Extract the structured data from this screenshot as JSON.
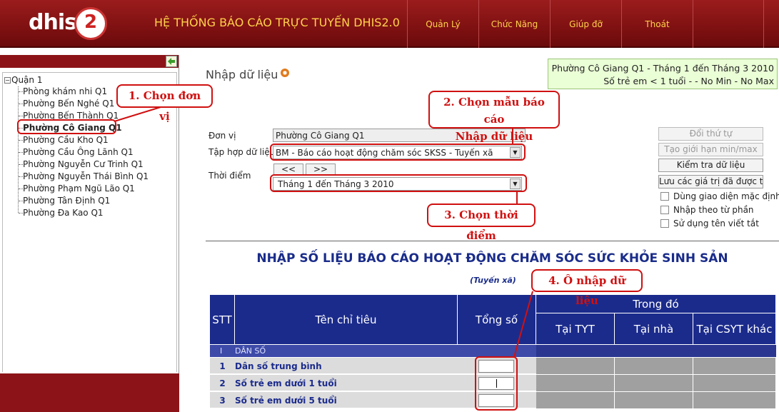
{
  "header": {
    "logo_text": "dhis",
    "logo_num": "2",
    "app_title": "HỆ THỐNG BÁO CÁO TRỰC TUYẾN DHIS2.0",
    "nav": [
      "Quản Lý",
      "Chức Năng",
      "Giúp đỡ",
      "Thoát"
    ]
  },
  "tree": {
    "root": "Quận 1",
    "items": [
      "Phòng khám nhi Q1",
      "Phường Bến Nghé Q1",
      "Phường Bến Thành Q1",
      "Phường Cô Giang Q1",
      "Phường Cầu Kho Q1",
      "Phường Cầu Ông Lãnh Q1",
      "Phường Nguyễn Cư Trinh Q1",
      "Phường Nguyễn Thái Bình Q1",
      "Phường Phạm Ngũ Lão Q1",
      "Phường Tân Định Q1",
      "Phường Đa Kao Q1"
    ],
    "selected_index": 3
  },
  "main": {
    "page_title": "Nhập dữ liệu",
    "info_line1": "Phường Cô Giang Q1 - Tháng 1 đến Tháng 3 2010",
    "info_line2": "Số trẻ em < 1 tuổi - - No Min - No Max",
    "form": {
      "org_label": "Đơn vị",
      "org_value": "Phường Cô Giang Q1",
      "dataset_label": "Tập hợp dữ liệu",
      "dataset_value": "BM - Báo cáo hoạt động chăm sóc SKSS - Tuyến xã",
      "period_label": "Thời điểm",
      "prev_label": "<<",
      "next_label": ">>",
      "period_value": "Tháng 1 đến Tháng 3 2010"
    },
    "buttons": [
      "Đổi thứ tự",
      "Tạo giới hạn min/max",
      "Kiểm tra dữ liệu",
      "Lưu các giá trị đã được tír"
    ],
    "checkboxes": [
      "Dùng giao diện mặc định",
      "Nhập theo từ phần",
      "Sử dụng tên viết tắt"
    ],
    "report_title": "NHẬP SỐ LIỆU BÁO CÁO HOẠT ĐỘNG CHĂM SÓC SỨC KHỎE SINH SẢN",
    "report_sub": "(Tuyến xã)",
    "table": {
      "h_stt": "STT",
      "h_name": "Tên chỉ tiêu",
      "h_total": "Tổng số",
      "h_group": "Trong đó",
      "h_tyt": "Tại TYT",
      "h_home": "Tại nhà",
      "h_other": "Tại CSYT khác",
      "section_no": "I",
      "section_name": "DÂN SỐ",
      "rows": [
        {
          "stt": "1",
          "name": "Dân số trung bình"
        },
        {
          "stt": "2",
          "name": "Số trẻ em dưới 1 tuổi"
        },
        {
          "stt": "3",
          "name": "Số trẻ em dưới 5 tuổi"
        }
      ]
    }
  },
  "annotations": {
    "a1": "1. Chọn đơn vị",
    "a2_line1": "2. Chọn mẫu báo cáo",
    "a2_line2": "Nhập dữ liệu",
    "a3": "3. Chọn thời điểm",
    "a4": "4. Ô nhập dữ liệu"
  }
}
